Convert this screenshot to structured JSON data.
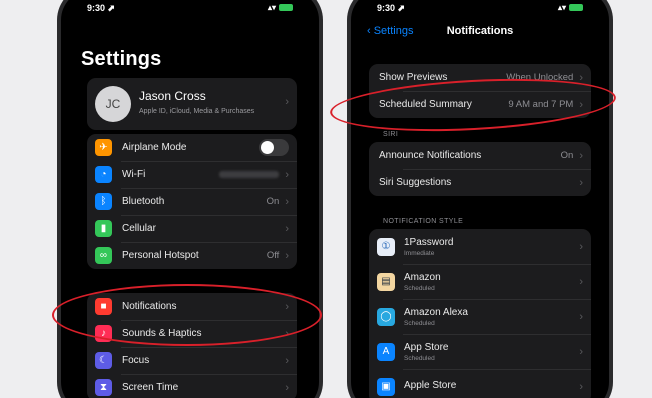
{
  "left_phone": {
    "status": {
      "time": "9:30 ⬈",
      "icons": "▴▾"
    },
    "title": "Settings",
    "profile": {
      "initials": "JC",
      "name": "Jason Cross",
      "subtitle": "Apple ID, iCloud, Media & Purchases"
    },
    "connectivity": [
      {
        "label": "Airplane Mode",
        "icon": "airplane-icon",
        "color": "#ff9500",
        "glyph": "✈",
        "kind": "toggle"
      },
      {
        "label": "Wi-Fi",
        "icon": "wifi-icon",
        "color": "#0a84ff",
        "glyph": "◔",
        "kind": "blurred"
      },
      {
        "label": "Bluetooth",
        "icon": "bluetooth-icon",
        "color": "#0a84ff",
        "glyph": "ᛒ",
        "value": "On"
      },
      {
        "label": "Cellular",
        "icon": "cellular-icon",
        "color": "#34c759",
        "glyph": "▮",
        "value": ""
      },
      {
        "label": "Personal Hotspot",
        "icon": "hotspot-icon",
        "color": "#34c759",
        "glyph": "∞",
        "value": "Off"
      }
    ],
    "notifications_group": [
      {
        "label": "Notifications",
        "icon": "notifications-icon",
        "color": "#ff3b30",
        "glyph": "■"
      },
      {
        "label": "Sounds & Haptics",
        "icon": "sounds-icon",
        "color": "#ff2d55",
        "glyph": "♪"
      },
      {
        "label": "Focus",
        "icon": "focus-moon-icon",
        "color": "#5e5ce6",
        "glyph": "☾"
      },
      {
        "label": "Screen Time",
        "icon": "screen-time-icon",
        "color": "#5e5ce6",
        "glyph": "⧗"
      }
    ]
  },
  "right_phone": {
    "status": {
      "time": "9:30 ⬈",
      "icons": "▴▾"
    },
    "nav": {
      "back": "‹ Settings",
      "title": "Notifications"
    },
    "summary_rows": [
      {
        "label": "Show Previews",
        "value": "When Unlocked"
      },
      {
        "label": "Scheduled Summary",
        "value": "9 AM and 7 PM"
      }
    ],
    "siri_header": "SIRI",
    "siri_rows": [
      {
        "label": "Announce Notifications",
        "value": "On"
      },
      {
        "label": "Siri Suggestions",
        "value": ""
      }
    ],
    "style_header": "NOTIFICATION STYLE",
    "apps": [
      {
        "name": "1Password",
        "detail": "Immediate",
        "icon": "onepassword-icon",
        "color": "#e8eef8",
        "glyph": "①",
        "glyph_color": "#1a5fb4"
      },
      {
        "name": "Amazon",
        "detail": "Scheduled",
        "icon": "amazon-icon",
        "color": "#f3d6a1",
        "glyph": "▤",
        "glyph_color": "#232f3e"
      },
      {
        "name": "Amazon Alexa",
        "detail": "Scheduled",
        "icon": "alexa-icon",
        "color": "#28a8e0",
        "glyph": "◯",
        "glyph_color": "#ffffff"
      },
      {
        "name": "App Store",
        "detail": "Scheduled",
        "icon": "app-store-icon",
        "color": "#0a84ff",
        "glyph": "A",
        "glyph_color": "#ffffff"
      },
      {
        "name": "Apple Store",
        "detail": "",
        "icon": "apple-store-icon",
        "color": "#0a84ff",
        "glyph": "▣",
        "glyph_color": "#ffffff"
      }
    ]
  },
  "annotation_color": "#d9202a"
}
